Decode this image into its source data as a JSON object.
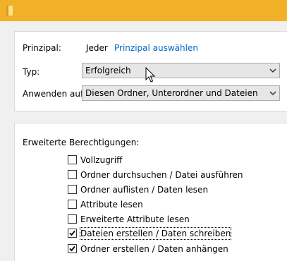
{
  "principal": {
    "label": "Prinzipal:",
    "value": "Jeder",
    "select_link": "Prinzipal auswählen"
  },
  "type": {
    "label": "Typ:",
    "selected": "Erfolgreich"
  },
  "applies_to": {
    "label": "Anwenden auf:",
    "selected": "Diesen Ordner, Unterordner und Dateien"
  },
  "advanced": {
    "heading": "Erweiterte Berechtigungen:",
    "permissions": [
      {
        "label": "Vollzugriff",
        "checked": false
      },
      {
        "label": "Ordner durchsuchen / Datei ausführen",
        "checked": false
      },
      {
        "label": "Ordner auflisten / Daten lesen",
        "checked": false
      },
      {
        "label": "Attribute lesen",
        "checked": false
      },
      {
        "label": "Erweiterte Attribute lesen",
        "checked": false
      },
      {
        "label": "Dateien erstellen / Daten schreiben",
        "checked": true
      },
      {
        "label": "Ordner erstellen / Daten anhängen",
        "checked": true
      }
    ]
  },
  "colors": {
    "titlebar": "#f0b126",
    "link": "#0066cc",
    "window_bg": "#f0f0f0"
  }
}
